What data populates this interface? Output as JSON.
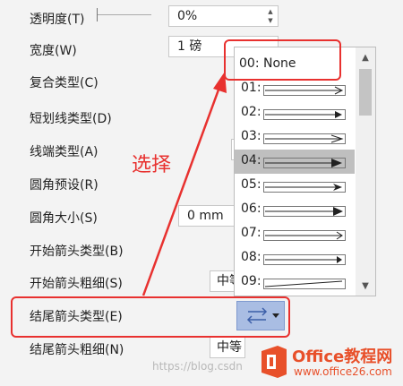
{
  "rows": {
    "transparency": {
      "label": "透明度(T)",
      "value": "0%"
    },
    "width": {
      "label": "宽度(W)",
      "value": "1 磅"
    },
    "compound_type": {
      "label": "复合类型(C)"
    },
    "dash_type": {
      "label": "短划线类型(D)"
    },
    "cap_type": {
      "label": "线端类型(A)"
    },
    "join_type": {
      "label": "圆角预设(R)"
    },
    "corner_size": {
      "label": "圆角大小(S)",
      "value": "0 mm"
    },
    "begin_arrow_type": {
      "label": "开始箭头类型(B)"
    },
    "begin_arrow_size": {
      "label": "开始箭头粗细(S)",
      "value": "中等"
    },
    "end_arrow_type": {
      "label": "结尾箭头类型(E)"
    },
    "end_arrow_size": {
      "label": "结尾箭头粗细(N)",
      "value": "中等"
    }
  },
  "dropdown": {
    "options": [
      {
        "num": "00: None"
      },
      {
        "num": "01:"
      },
      {
        "num": "02:"
      },
      {
        "num": "03:"
      },
      {
        "num": "04:"
      },
      {
        "num": "05:"
      },
      {
        "num": "06:"
      },
      {
        "num": "07:"
      },
      {
        "num": "08:"
      },
      {
        "num": "09:"
      }
    ],
    "selected_index": 4
  },
  "annotation": "选择",
  "watermark": {
    "url": "https://blog.csdn",
    "brand_title": "Office教程网",
    "brand_url": "www.office26.com"
  },
  "colors": {
    "highlight": "#e8312f",
    "button_blue": "#a9bde3",
    "logo_orange": "#e8502a"
  }
}
